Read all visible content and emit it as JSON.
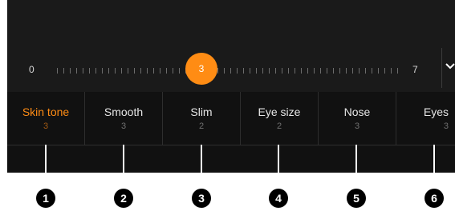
{
  "slider": {
    "min_label": "0",
    "max_label": "7",
    "value_label": "3",
    "value": 3,
    "min": 0,
    "max": 7
  },
  "tabs": [
    {
      "label": "Skin tone",
      "value": "3",
      "active": true
    },
    {
      "label": "Smooth",
      "value": "3",
      "active": false
    },
    {
      "label": "Slim",
      "value": "2",
      "active": false
    },
    {
      "label": "Eye size",
      "value": "2",
      "active": false
    },
    {
      "label": "Nose",
      "value": "3",
      "active": false
    },
    {
      "label": "Eyes",
      "value": "3",
      "active": false
    }
  ],
  "callouts": [
    "1",
    "2",
    "3",
    "4",
    "5",
    "6"
  ],
  "colors": {
    "accent": "#ff8c14",
    "panel": "#1a1a1a",
    "tab_bar": "#111111"
  },
  "icons": {
    "expand": "chevron-down-icon"
  }
}
